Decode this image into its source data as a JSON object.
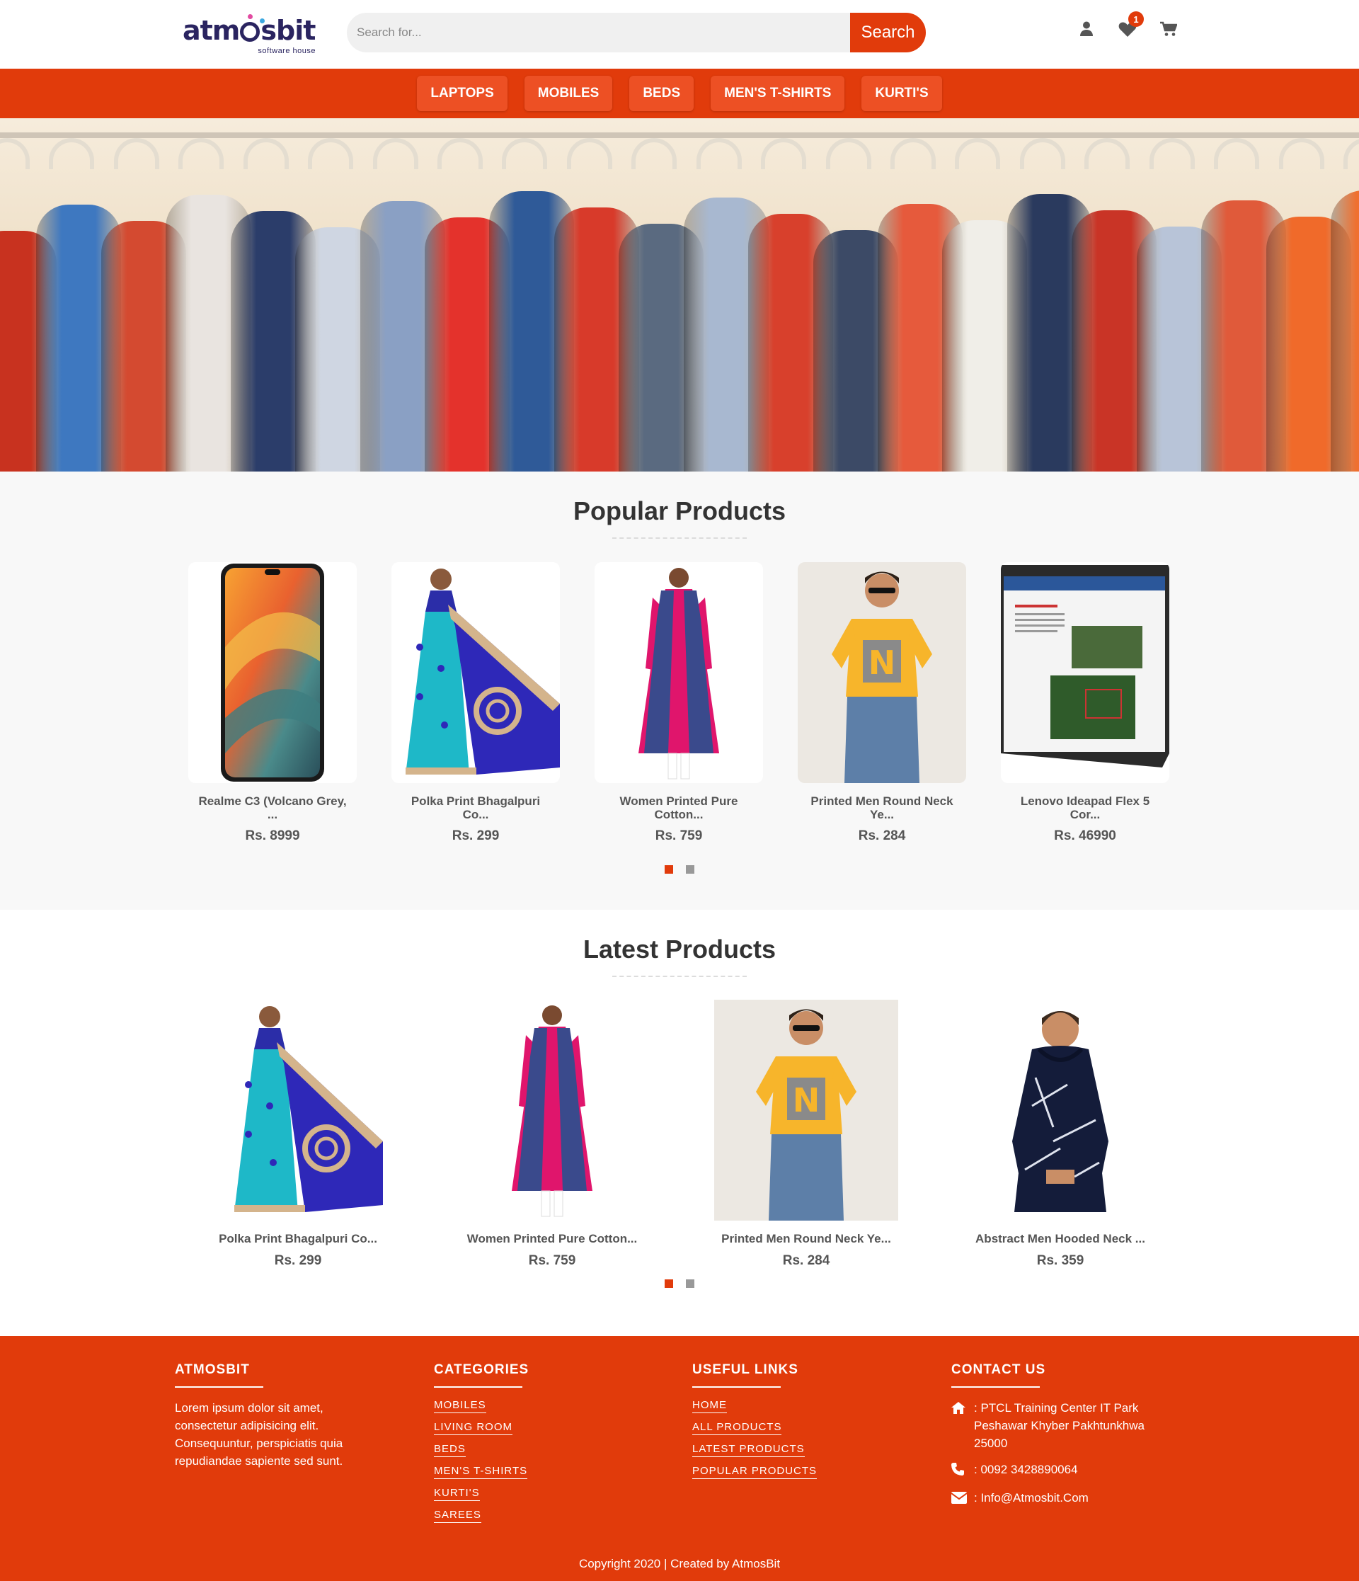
{
  "brand": {
    "name": "atmosbit",
    "tagline": "software house"
  },
  "search": {
    "placeholder": "Search for...",
    "button_label": "Search"
  },
  "header_icons": {
    "user": "user-icon",
    "wishlist": "heart-icon",
    "wishlist_count": "1",
    "cart": "cart-icon"
  },
  "nav": {
    "items": [
      {
        "label": "LAPTOPS"
      },
      {
        "label": "MOBILES"
      },
      {
        "label": "BEDS"
      },
      {
        "label": "MEN'S T-SHIRTS"
      },
      {
        "label": "KURTI'S"
      }
    ]
  },
  "popular": {
    "title": "Popular Products",
    "products": [
      {
        "name": "Realme C3 (Volcano Grey, ...",
        "price": "Rs. 8999"
      },
      {
        "name": "Polka Print Bhagalpuri Co...",
        "price": "Rs. 299"
      },
      {
        "name": "Women Printed Pure Cotton...",
        "price": "Rs. 759"
      },
      {
        "name": "Printed Men Round Neck Ye...",
        "price": "Rs. 284"
      },
      {
        "name": "Lenovo Ideapad Flex 5 Cor...",
        "price": "Rs. 46990"
      }
    ],
    "slides": 2,
    "active_slide": 1
  },
  "latest": {
    "title": "Latest Products",
    "products": [
      {
        "name": "Polka Print Bhagalpuri Co...",
        "price": "Rs. 299"
      },
      {
        "name": "Women Printed Pure Cotton...",
        "price": "Rs. 759"
      },
      {
        "name": "Printed Men Round Neck Ye...",
        "price": "Rs. 284"
      },
      {
        "name": "Abstract Men Hooded Neck ...",
        "price": "Rs. 359"
      }
    ],
    "slides": 2,
    "active_slide": 1
  },
  "footer": {
    "about": {
      "title": "ATMOSBIT",
      "text": "Lorem ipsum dolor sit amet, consectetur adipisicing elit. Consequuntur, perspiciatis quia repudiandae sapiente sed sunt."
    },
    "categories": {
      "title": "CATEGORIES",
      "links": [
        "MOBILES",
        "LIVING ROOM",
        "BEDS",
        "MEN'S T-SHIRTS",
        "KURTI'S",
        "SAREES"
      ]
    },
    "useful_links": {
      "title": "USEFUL LINKS",
      "links": [
        "HOME",
        "ALL PRODUCTS",
        "LATEST PRODUCTS",
        "POPULAR PRODUCTS"
      ]
    },
    "contact": {
      "title": "CONTACT US",
      "address": ": PTCL Training Center IT Park Peshawar Khyber Pakhtunkhwa 25000",
      "phone": ": 0092 3428890064",
      "email": ": Info@Atmosbit.Com"
    },
    "copyright": "Copyright 2020 | Created by AtmosBit"
  },
  "colors": {
    "accent": "#e13b0b",
    "nav_button": "#ed5024",
    "brand_text": "#2a2460"
  }
}
